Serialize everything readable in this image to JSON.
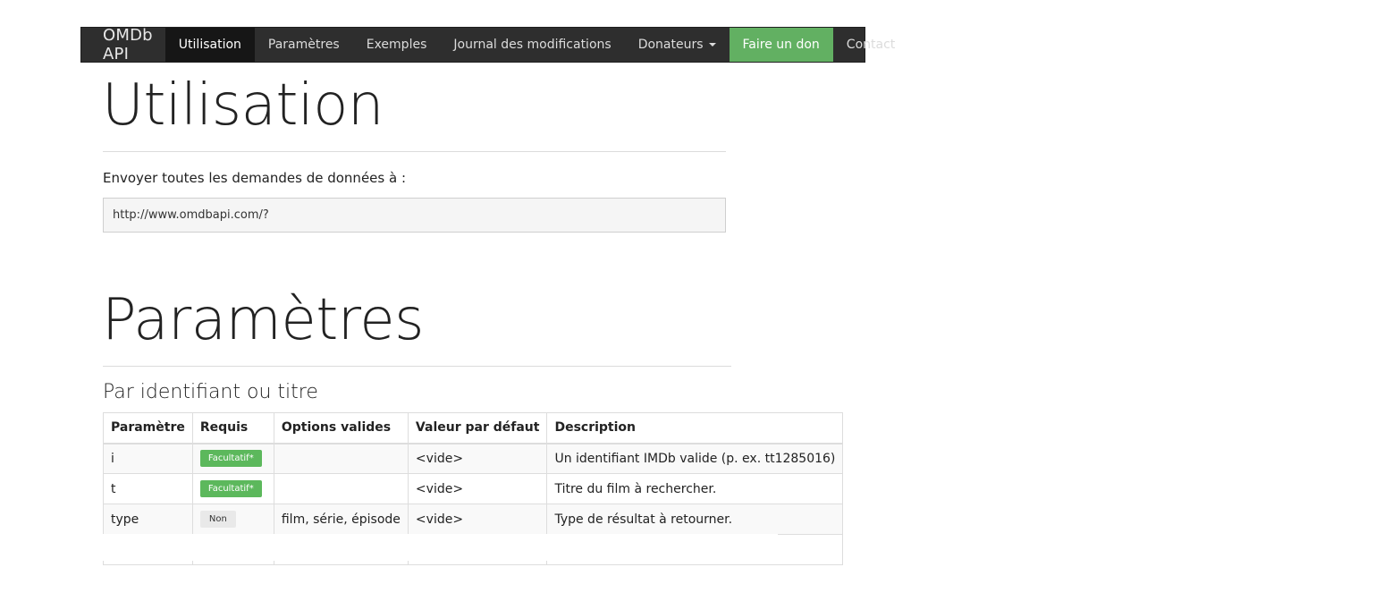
{
  "nav": {
    "brand": "OMDb API",
    "items": [
      {
        "label": "Utilisation"
      },
      {
        "label": "Paramètres"
      },
      {
        "label": "Exemples"
      },
      {
        "label": "Journal des modifications"
      },
      {
        "label": "Donateurs"
      },
      {
        "label": "Faire un don"
      },
      {
        "label": "Contact"
      }
    ]
  },
  "usage": {
    "title": "Utilisation",
    "lead": "Envoyer toutes les demandes de données à :",
    "url": "http://www.omdbapi.com/?"
  },
  "params": {
    "title": "Paramètres",
    "subtitle": "Par identifiant ou titre",
    "headers": [
      "Paramètre",
      "Requis",
      "Options valides",
      "Valeur par défaut",
      "Description"
    ],
    "rows": [
      {
        "param": "i",
        "required": "Facultatif*",
        "options": "",
        "default": "<vide>",
        "description": "Un identifiant IMDb valide (p. ex. tt1285016)"
      },
      {
        "param": "t",
        "required": "Facultatif*",
        "options": "",
        "default": "<vide>",
        "description": "Titre du film à rechercher."
      },
      {
        "param": "type",
        "required": "Non",
        "options": "film, série, épisode",
        "default": "<vide>",
        "description": "Type de résultat à retourner."
      },
      {
        "param": "",
        "required": "",
        "options": "",
        "default": "",
        "description": ""
      }
    ]
  },
  "colors": {
    "navbar": "#2e2e2e",
    "active_item": "#161616",
    "donate": "#62b062",
    "badge_required": "#5cb85c",
    "badge_no": "#e9e9e9"
  }
}
